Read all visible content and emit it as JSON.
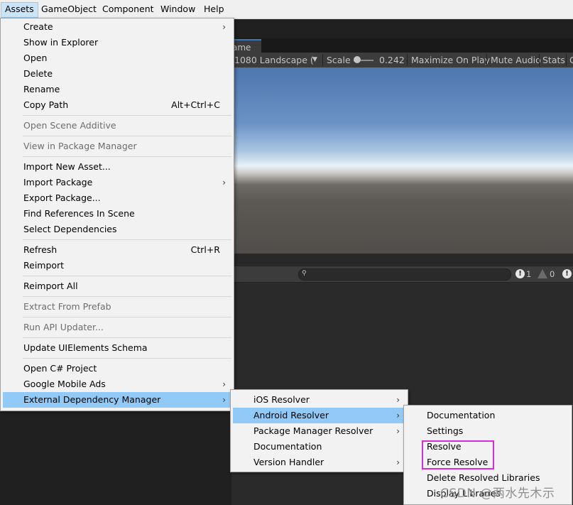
{
  "menubar": {
    "items": [
      "Assets",
      "GameObject",
      "Component",
      "Window",
      "Help"
    ]
  },
  "game_view": {
    "tab_label": "ame",
    "resolution": "1080 Landscape (1",
    "resolution_arrow": "▼",
    "scale_label": "Scale",
    "scale_value": "0.242",
    "maximize_on_play": "Maximize On Play",
    "mute_audio": "Mute Audio",
    "stats": "Stats",
    "gizmos_partial": "G"
  },
  "console": {
    "search_icon": "search-icon",
    "error_count": "1",
    "warning_count": "0",
    "error_glyph": "!",
    "info_glyph": "!"
  },
  "assets_menu": {
    "items": [
      {
        "label": "Create",
        "submenu": true
      },
      {
        "label": "Show in Explorer"
      },
      {
        "label": "Open"
      },
      {
        "label": "Delete"
      },
      {
        "label": "Rename"
      },
      {
        "label": "Copy Path",
        "shortcut": "Alt+Ctrl+C"
      },
      {
        "label": "Open Scene Additive",
        "disabled": true
      },
      {
        "label": "View in Package Manager",
        "disabled": true
      },
      {
        "label": "Import New Asset..."
      },
      {
        "label": "Import Package",
        "submenu": true
      },
      {
        "label": "Export Package..."
      },
      {
        "label": "Find References In Scene"
      },
      {
        "label": "Select Dependencies"
      },
      {
        "label": "Refresh",
        "shortcut": "Ctrl+R"
      },
      {
        "label": "Reimport"
      },
      {
        "label": "Reimport All"
      },
      {
        "label": "Extract From Prefab",
        "disabled": true
      },
      {
        "label": "Run API Updater...",
        "disabled": true
      },
      {
        "label": "Update UIElements Schema"
      },
      {
        "label": "Open C# Project"
      },
      {
        "label": "Google Mobile Ads",
        "submenu": true
      },
      {
        "label": "External Dependency Manager",
        "submenu": true,
        "highlighted": true
      }
    ]
  },
  "edm_menu": {
    "items": [
      {
        "label": "iOS Resolver",
        "submenu": true
      },
      {
        "label": "Android Resolver",
        "submenu": true,
        "highlighted": true
      },
      {
        "label": "Package Manager Resolver",
        "submenu": true
      },
      {
        "label": "Documentation"
      },
      {
        "label": "Version Handler",
        "submenu": true
      }
    ]
  },
  "android_menu": {
    "items": [
      {
        "label": "Documentation"
      },
      {
        "label": "Settings"
      },
      {
        "label": "Resolve"
      },
      {
        "label": "Force Resolve"
      },
      {
        "label": "Delete Resolved Libraries"
      },
      {
        "label": "Display Libraries"
      }
    ]
  },
  "watermark": "CSDN @两水先木示",
  "colors": {
    "menu_highlight": "#91c9f7",
    "annotation_box": "#d62dd6"
  },
  "submenu_arrow": "›"
}
